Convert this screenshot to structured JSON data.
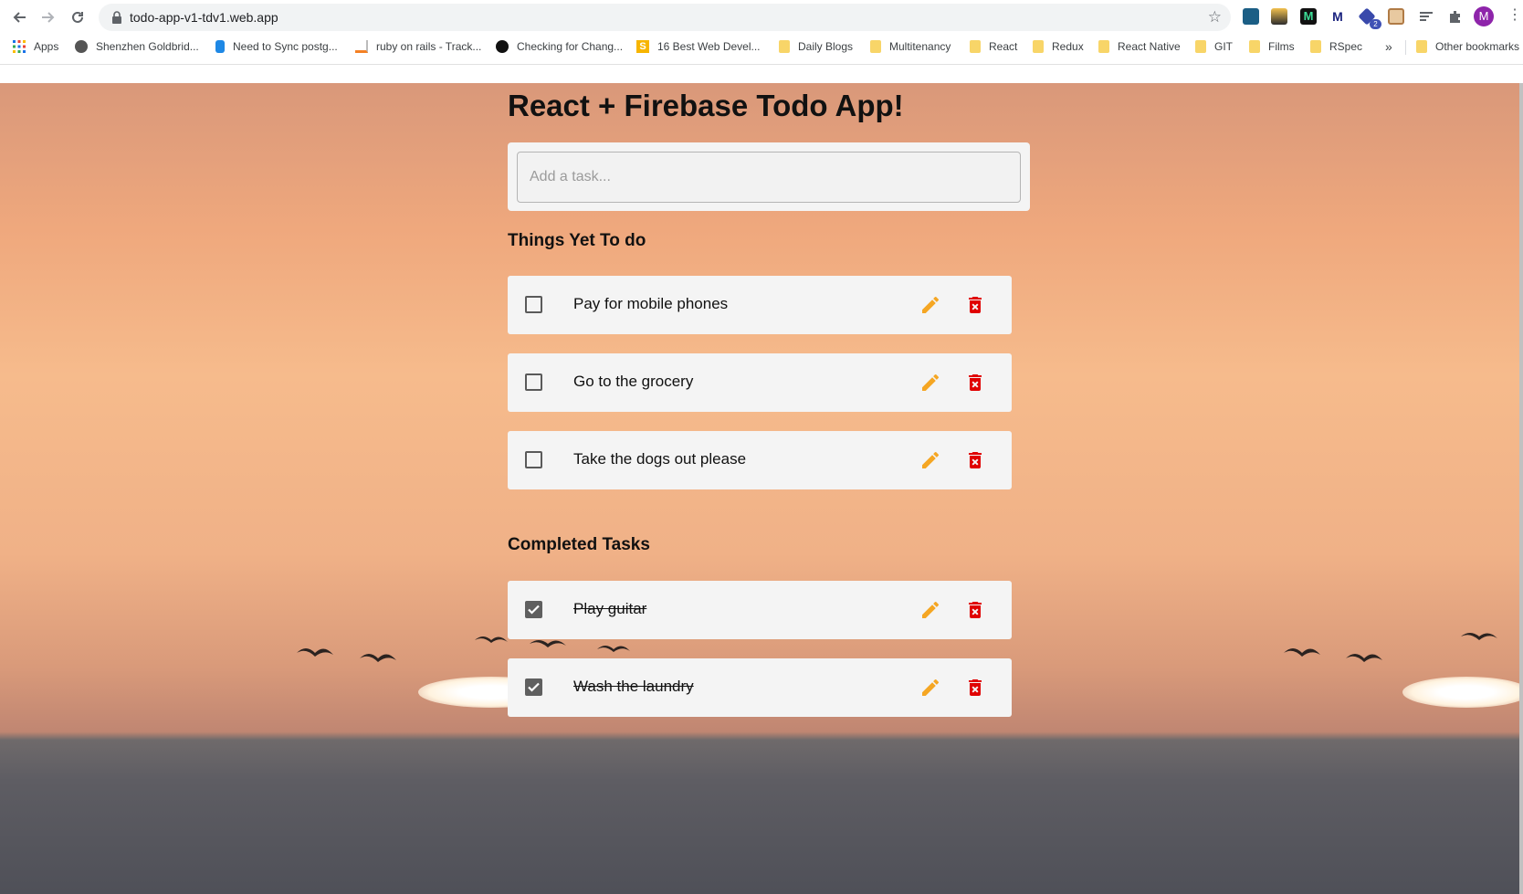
{
  "browser": {
    "url": "todo-app-v1-tdv1.web.app",
    "extension_badge": "2",
    "profile_initial": "M",
    "bookmarks": [
      {
        "label": "Apps",
        "icon": "apps-grid-icon"
      },
      {
        "label": "Shenzhen Goldbrid...",
        "icon": "globe-icon"
      },
      {
        "label": "Need to Sync postg...",
        "icon": "database-icon"
      },
      {
        "label": "ruby on rails - Track...",
        "icon": "stackoverflow-icon"
      },
      {
        "label": "Checking for Chang...",
        "icon": "github-icon"
      },
      {
        "label": "16 Best Web Devel...",
        "icon": "site-s-icon"
      },
      {
        "label": "Daily Blogs",
        "icon": "folder-icon"
      },
      {
        "label": "Multitenancy",
        "icon": "folder-icon"
      },
      {
        "label": "React",
        "icon": "folder-icon"
      },
      {
        "label": "Redux",
        "icon": "folder-icon"
      },
      {
        "label": "React Native",
        "icon": "folder-icon"
      },
      {
        "label": "GIT",
        "icon": "folder-icon"
      },
      {
        "label": "Films",
        "icon": "folder-icon"
      },
      {
        "label": "RSpec",
        "icon": "folder-icon"
      }
    ],
    "overflow_label": "»",
    "other_bookmarks": "Other bookmarks"
  },
  "app": {
    "title": "React + Firebase Todo App!",
    "input_placeholder": "Add a task...",
    "pending_heading": "Things Yet To do",
    "completed_heading": "Completed Tasks",
    "pending": [
      {
        "text": "Pay for mobile phones",
        "done": false
      },
      {
        "text": "Go to the grocery",
        "done": false
      },
      {
        "text": "Take the dogs out please",
        "done": false
      }
    ],
    "completed": [
      {
        "text": "Play guitar",
        "done": true
      },
      {
        "text": "Wash the laundry",
        "done": true
      }
    ]
  },
  "colors": {
    "edit_icon": "#f5a623",
    "delete_icon": "#e00000",
    "card_bg": "#f4f4f4",
    "profile_avatar": "#8e24aa"
  }
}
